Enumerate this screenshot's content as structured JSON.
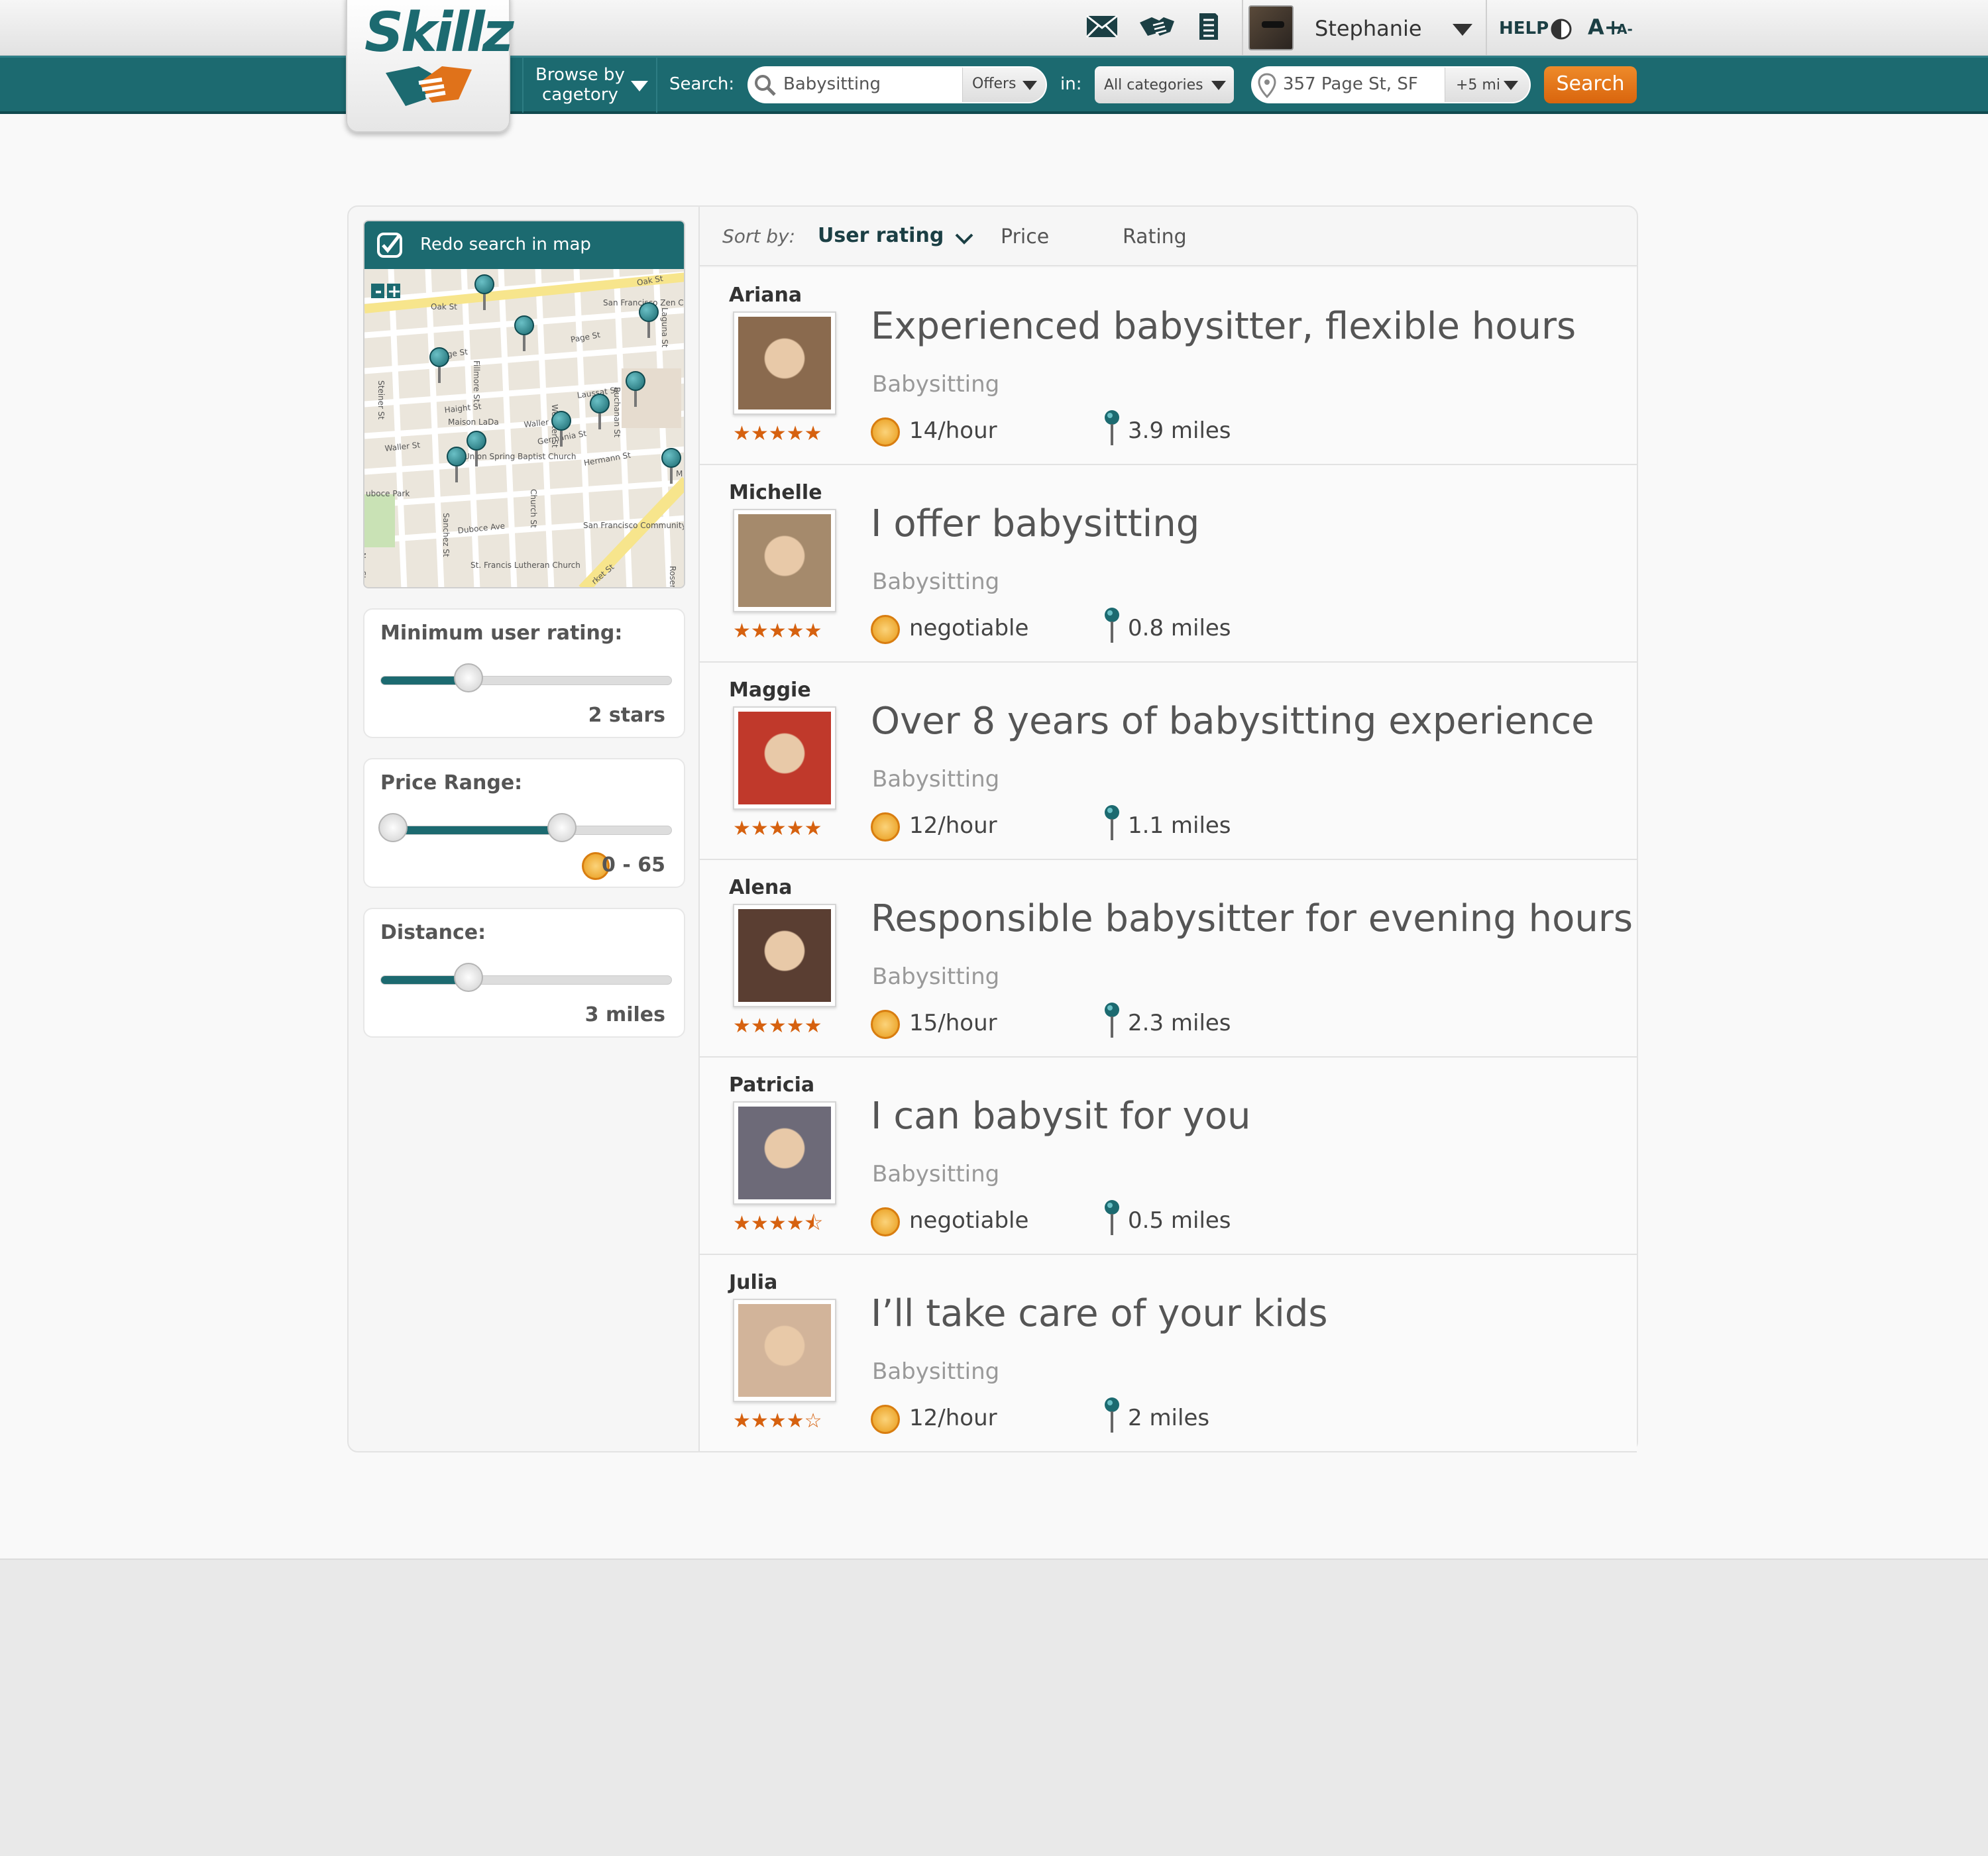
{
  "app": {
    "logo_text": "Skillz"
  },
  "topbar": {
    "user_name": "Stephanie",
    "help_label": "HELP",
    "font_increase": "A+",
    "font_decrease": "A-"
  },
  "nav": {
    "browse_line1": "Browse by",
    "browse_line2": "cagetory",
    "search_label": "Search:",
    "search_value": "Babysitting",
    "search_type": "Offers",
    "in_label": "in:",
    "category": "All categories",
    "location": "357 Page St, SF",
    "radius": "+5 mi",
    "search_button": "Search"
  },
  "map": {
    "redo_label": "Redo search in map",
    "zoom_out": "-",
    "zoom_in": "+",
    "streets": [
      "Oak St",
      "Oak St",
      "Page St",
      "Page St",
      "Haight St",
      "Laussat St",
      "Waller St",
      "Waller St",
      "Germania St",
      "Hermann St",
      "Duboce Ave",
      "Union Spring Baptist Church",
      "San Francisco Zen Center",
      "San Francisco Community Recyclers",
      "St. Francis Lutheran Church",
      "Maison LaDa",
      "uboce Park",
      "Fillmore St",
      "Steiner St",
      "Webster St",
      "Buchanan St",
      "Church St",
      "Sanchez St",
      "Laguna St",
      "rket St",
      "Noe St",
      "M",
      "Rosemar"
    ]
  },
  "filters": {
    "rating": {
      "label": "Minimum user rating:",
      "value": "2 stars",
      "level": 0.3
    },
    "price": {
      "label": "Price Range:",
      "value": "0 - 65",
      "low": 0.0,
      "high": 0.62
    },
    "distance": {
      "label": "Distance:",
      "value": "3 miles",
      "level": 0.3
    }
  },
  "sort": {
    "label": "Sort by:",
    "active": "User rating",
    "options": [
      "Price",
      "Rating"
    ]
  },
  "listings": [
    {
      "name": "Ariana",
      "title": "Experienced babysitter, flexible hours",
      "category": "Babysitting",
      "price": "14/hour",
      "distance": "3.9 miles",
      "stars": "★★★★★",
      "rating": 5,
      "photo_color": "#8a6a4e"
    },
    {
      "name": "Michelle",
      "title": "I offer babysitting",
      "category": "Babysitting",
      "price": "negotiable",
      "distance": "0.8 miles",
      "stars": "★★★★★",
      "rating": 5,
      "photo_color": "#a58a6c"
    },
    {
      "name": "Maggie",
      "title": "Over 8 years of babysitting experience",
      "category": "Babysitting",
      "price": "12/hour",
      "distance": "1.1 miles",
      "stars": "★★★★★",
      "rating": 5,
      "photo_color": "#c0392b"
    },
    {
      "name": "Alena",
      "title": "Responsible babysitter for evening hours",
      "category": "Babysitting",
      "price": "15/hour",
      "distance": "2.3 miles",
      "stars": "★★★★★",
      "rating": 5,
      "photo_color": "#5a3e32"
    },
    {
      "name": "Patricia",
      "title": "I can babysit for you",
      "category": "Babysitting",
      "price": "negotiable",
      "distance": "0.5 miles",
      "stars": "★★★★⯪",
      "rating": 4.5,
      "photo_color": "#6d6a78"
    },
    {
      "name": "Julia",
      "title": "I’ll take care of your kids",
      "category": "Babysitting",
      "price": "12/hour",
      "distance": "2 miles",
      "stars": "★★★★☆",
      "rating": 4,
      "photo_color": "#d2b49a"
    }
  ],
  "colors": {
    "brand_teal": "#1c6a70",
    "accent_orange": "#e0721a",
    "star_orange": "#d6610f"
  }
}
